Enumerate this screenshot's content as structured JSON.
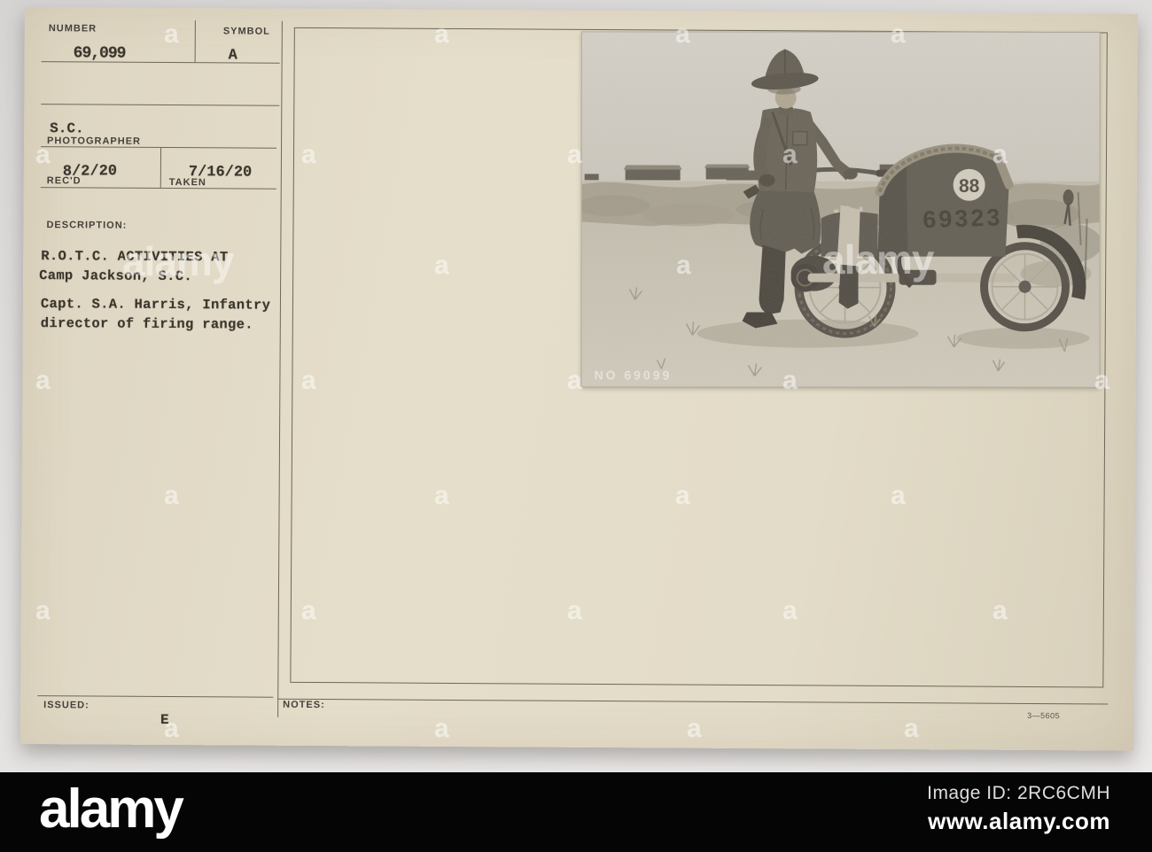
{
  "card": {
    "fields": {
      "number_label": "NUMBER",
      "number_value": "69,099",
      "symbol_label": "SYMBOL",
      "symbol_value": "A",
      "photographer_value": "S.C.",
      "photographer_label": "PHOTOGRAPHER",
      "recd_label": "REC'D",
      "recd_value": "8/2/20",
      "taken_label": "TAKEN",
      "taken_value": "7/16/20",
      "description_label": "DESCRIPTION:",
      "issued_label": "ISSUED:",
      "issued_value": "E",
      "notes_label": "NOTES:",
      "print_code": "3—5605"
    },
    "description_lines": [
      "R.O.T.C. ACTIVITIES AT",
      "Camp Jackson, S.C.",
      "Capt. S.A. Harris, Infantry",
      "director of firing range."
    ]
  },
  "photo": {
    "sidecar_race_number": "88",
    "sidecar_serial_number": "69323",
    "corner_stamp": "NO 69099"
  },
  "watermark": {
    "tile_glyph": "a",
    "word": "alamy"
  },
  "footer": {
    "logo_text": "alamy",
    "image_id_text": "Image ID: 2RC6CMH",
    "site_url": "www.alamy.com"
  },
  "colors": {
    "card_paper": "#e3dcc8",
    "ink": "#3a352d",
    "rule_line": "#6e6758",
    "footer_bg": "#050505",
    "watermark": "#ffffff"
  }
}
